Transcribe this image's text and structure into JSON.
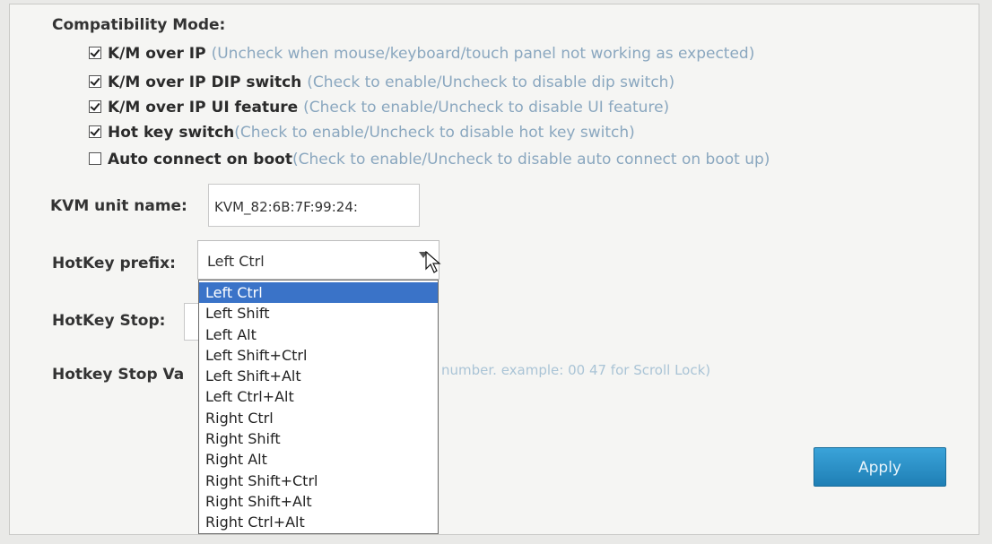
{
  "compatibility": {
    "title": "Compatibility Mode:",
    "options": [
      {
        "label": "K/M over IP",
        "hint": "(Uncheck when mouse/keyboard/touch panel not working as expected)",
        "checked": true
      },
      {
        "label": "K/M over IP DIP switch",
        "hint": "(Check to enable/Uncheck to disable dip switch)",
        "checked": true
      },
      {
        "label": "K/M over IP UI feature",
        "hint": "(Check to enable/Uncheck to disable UI feature)",
        "checked": true
      },
      {
        "label": "Hot key switch",
        "hint": "(Check to enable/Uncheck to disable hot key switch)",
        "checked": true
      },
      {
        "label": "Auto connect on boot",
        "hint": "(Check to enable/Uncheck to disable auto connect on boot up)",
        "checked": false
      }
    ]
  },
  "kvm_unit_name": {
    "label": "KVM unit name:",
    "value": "KVM_82:6B:7F:99:24:"
  },
  "hotkey_prefix": {
    "label": "HotKey prefix:",
    "selected": "Left Ctrl",
    "options": [
      "Left Ctrl",
      "Left Shift",
      "Left Alt",
      "Left Shift+Ctrl",
      "Left Shift+Alt",
      "Left Ctrl+Alt",
      "Right Ctrl",
      "Right Shift",
      "Right Alt",
      "Right Shift+Ctrl",
      "Right Shift+Alt",
      "Right Ctrl+Alt"
    ]
  },
  "hotkey_stop": {
    "label": "HotKey Stop:"
  },
  "hotkey_stop_value": {
    "label": "Hotkey Stop Va",
    "hint": "number. example: 00 47 for Scroll Lock)"
  },
  "apply_label": "Apply",
  "colors": {
    "hint": "#8aa7bf",
    "selected_option": "#3a73c8",
    "apply": "#2a92c9"
  }
}
